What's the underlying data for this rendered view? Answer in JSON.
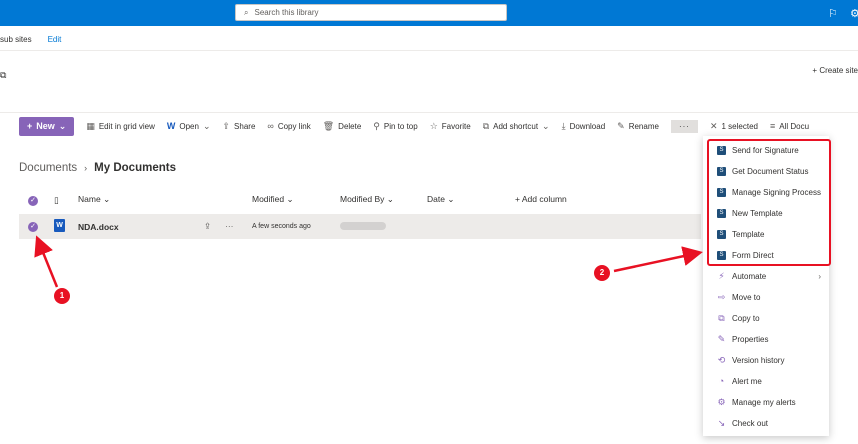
{
  "search": {
    "placeholder": "Search this library"
  },
  "subnav": {
    "items": [
      "sub sites",
      "Edit"
    ]
  },
  "header": {
    "create_site": "Create site"
  },
  "toolbar": {
    "new": "New",
    "edit_grid": "Edit in grid view",
    "open": "Open",
    "share": "Share",
    "copy_link": "Copy link",
    "delete": "Delete",
    "pin": "Pin to top",
    "favorite": "Favorite",
    "add_shortcut": "Add shortcut",
    "download": "Download",
    "rename": "Rename",
    "more": "···",
    "selected": "1 selected",
    "all_docs": "All Docu"
  },
  "breadcrumb": {
    "parent": "Documents",
    "current": "My Documents"
  },
  "columns": {
    "name": "Name",
    "modified": "Modified",
    "modified_by": "Modified By",
    "date": "Date",
    "add_column": "Add column"
  },
  "file": {
    "name": "NDA.docx",
    "modified": "A few seconds ago"
  },
  "menu": {
    "items": [
      "Send for Signature",
      "Get Document Status",
      "Manage Signing Process",
      "New Template",
      "Template",
      "Form Direct",
      "Automate",
      "Move to",
      "Copy to",
      "Properties",
      "Version history",
      "Alert me",
      "Manage my alerts",
      "Check out"
    ]
  },
  "annotations": {
    "badge1": "1",
    "badge2": "2"
  },
  "colors": {
    "accent": "#8764b8",
    "topbar": "#0078d4",
    "highlight": "#e81123"
  }
}
